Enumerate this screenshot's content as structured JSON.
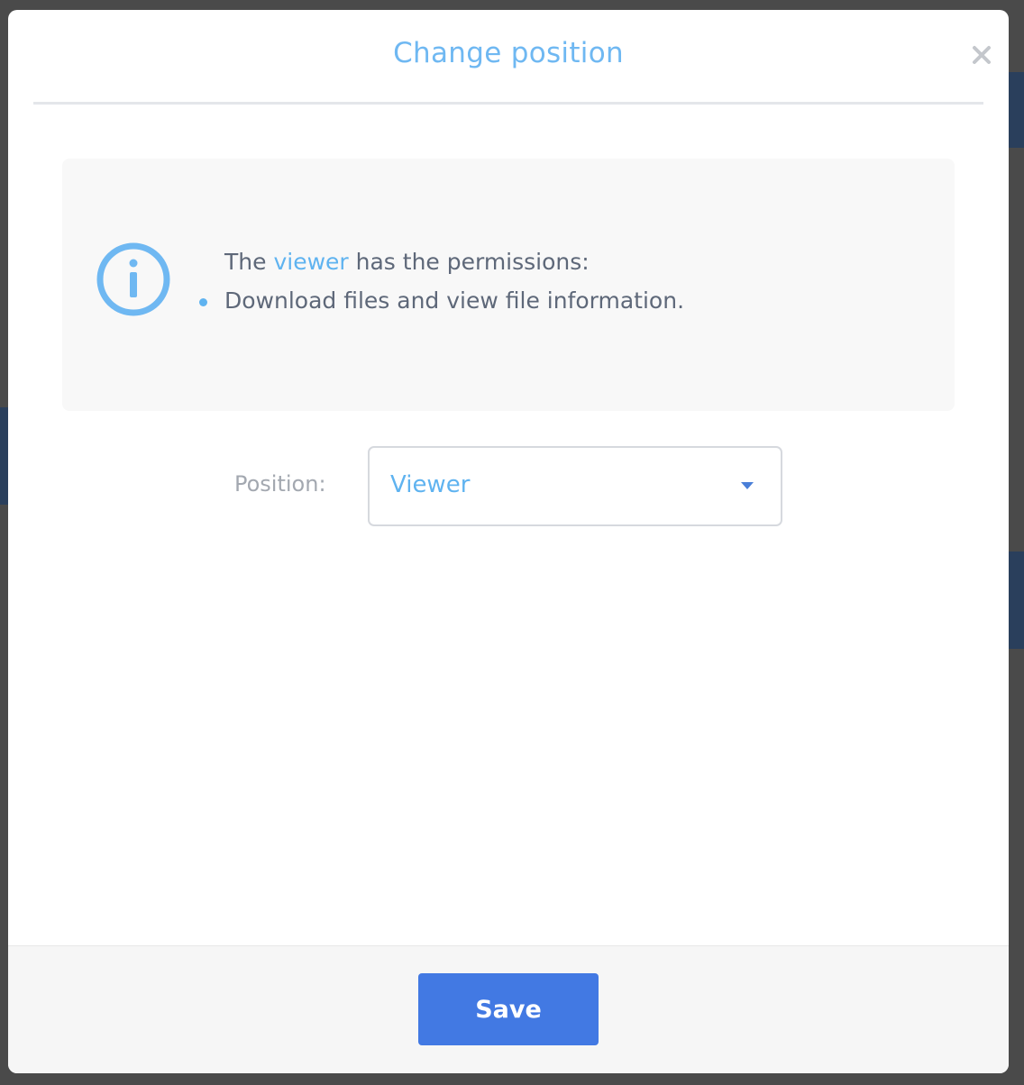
{
  "modal": {
    "title": "Change position",
    "close_icon": "close-icon"
  },
  "info": {
    "icon": "info-icon",
    "line1_prefix": "The ",
    "role_name": "viewer",
    "line1_suffix": " has the permissions:",
    "permissions": [
      "Download files and view file information."
    ]
  },
  "form": {
    "position_label": "Position:",
    "position_value": "Viewer"
  },
  "footer": {
    "save_label": "Save"
  },
  "colors": {
    "accent": "#5fb3f0",
    "primary_button": "#4279e3",
    "text": "#5e6879"
  }
}
